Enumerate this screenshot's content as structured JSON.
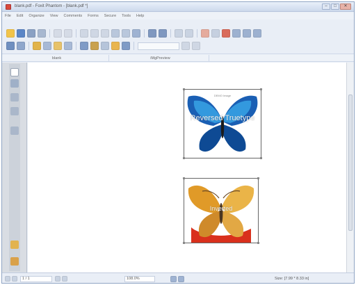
{
  "window": {
    "title": "blank.pdf - Foxit Phantom - [blank.pdf *]",
    "controls": [
      "–",
      "□",
      "✕"
    ]
  },
  "menubar": {
    "items": [
      "File",
      "Edit",
      "Organize",
      "View",
      "Comments",
      "Forms",
      "Secure",
      "Tools",
      "Help"
    ]
  },
  "panel_tabs": [
    "blank",
    "iMgPreview"
  ],
  "document": {
    "image1": {
      "overlay_text": "Reversed Truetype",
      "demo_label": "DEMO Image"
    },
    "image2": {
      "overlay_text": "Inverted"
    }
  },
  "statusbar": {
    "page_nav": "1 / 1",
    "zoom": "108.0%",
    "size": "Size: [7.99 * 8.33 in]"
  },
  "colors": {
    "accent": "#2c5fa8",
    "title_bar": "#cdd9ec",
    "page_bg": "#ffffff",
    "sidebar_bg": "#d9dde3"
  }
}
